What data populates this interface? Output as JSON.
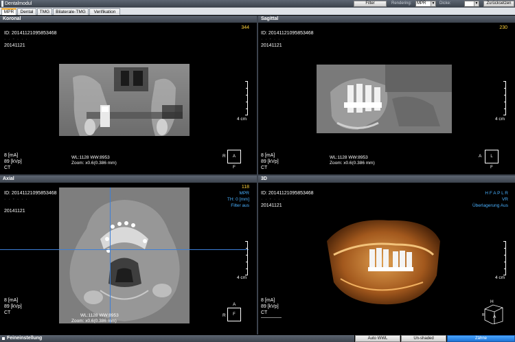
{
  "app": {
    "title": "Dentalmodul"
  },
  "toolbar": {
    "filter_label": "Filter",
    "rendering_label": "Rendering:",
    "rendering_value": "MPR",
    "dicke_label": "Dicke:",
    "dicke_value": "",
    "reset_label": "Zurücksetzen"
  },
  "tabs": [
    {
      "label": "MPR"
    },
    {
      "label": "Dental"
    },
    {
      "label": "TMG"
    },
    {
      "label": "Bilaterale-TMG"
    },
    {
      "label": "Verifikation"
    }
  ],
  "panels": {
    "coronal": {
      "title": "Koronal",
      "slice": "344",
      "id_line": "ID: 20141121095853468",
      "date": "20141121",
      "ma": "8 [mA]",
      "kvp": "89 [kVp]",
      "modality": "CT",
      "wl": "WL:1128 WW:8953",
      "zoom": "Zoom: x0.6(0.386 mm)",
      "scale": "4 cm",
      "orient_left": "R",
      "orient_box": "A",
      "orient_bottom": "F"
    },
    "sagittal": {
      "title": "Sagittal",
      "slice": "230",
      "id_line": "ID: 20141121095853468",
      "date": "20141121",
      "ma": "8 [mA]",
      "kvp": "89 [kVp]",
      "modality": "CT",
      "wl": "WL:1128 WW:8953",
      "zoom": "Zoom: x0.6(0.386 mm)",
      "scale": "4 cm",
      "orient_left": "A",
      "orient_box": "L",
      "orient_bottom": "F"
    },
    "axial": {
      "title": "Axial",
      "slice": "118",
      "id_line": "ID: 20141121095853468",
      "date": "20141121",
      "mpr": "MPR",
      "th": "TH: 0 [mm]",
      "filter": "Filter aus",
      "ma": "8 [mA]",
      "kvp": "89 [kVp]",
      "modality": "CT",
      "wl": "WL:1128 WW:8953",
      "zoom": "Zoom: x0.6(0.386 mm)",
      "scale": "4 cm",
      "orient_top": "A",
      "orient_left": "R",
      "orient_box": "F"
    },
    "three_d": {
      "title": "3D",
      "id_line": "ID: 20141121095853468",
      "date": "20141121",
      "directions": "H F A P L R",
      "vr": "VR",
      "overlay": "Überlagerung Aus",
      "ma": "8 [mA]",
      "kvp": "89 [kVp]",
      "modality": "CT",
      "scale": "4 cm",
      "cube_top": "H",
      "cube_left": "R",
      "cube_face": "A"
    }
  },
  "footer": {
    "fine_label": "Feineinstellung",
    "auto_wwl": "Auto WWL",
    "unshaded": "Un-shaded",
    "teeth": "Zähne"
  },
  "colors": {
    "slice_number": "#ffd23a",
    "info_blue": "#4ab1ff",
    "active_tab": "#f0a21c",
    "crosshair": "#3d7fd6"
  }
}
